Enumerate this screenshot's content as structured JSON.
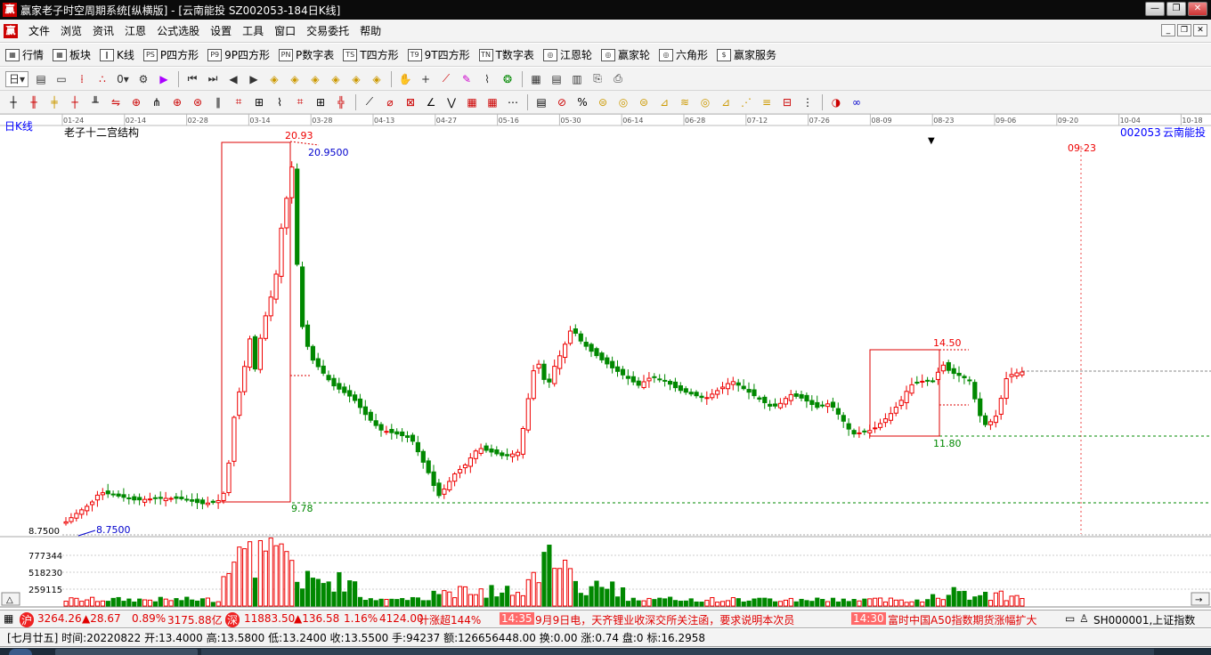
{
  "window": {
    "title": "赢家老子时空周期系统[纵横版] - [云南能投  SZ002053-184日K线]",
    "logo": "赢",
    "buttons": [
      "—",
      "❐",
      "✕"
    ]
  },
  "menu": {
    "logo": "赢",
    "items": [
      "文件",
      "浏览",
      "资讯",
      "江恩",
      "公式选股",
      "设置",
      "工具",
      "窗口",
      "交易委托",
      "帮助"
    ],
    "mdi_buttons": [
      "_",
      "❐",
      "✕"
    ]
  },
  "toolbar": {
    "items": [
      {
        "icon": "grid-icon",
        "glyph": "▦",
        "label": "行情"
      },
      {
        "icon": "blocks-icon",
        "glyph": "▦",
        "label": "板块"
      },
      {
        "icon": "kline-icon",
        "glyph": "‖",
        "label": "K线"
      },
      {
        "icon": "ps-icon",
        "glyph": "PS",
        "label": "P四方形"
      },
      {
        "icon": "p9-icon",
        "glyph": "P9",
        "label": "9P四方形"
      },
      {
        "icon": "pn-icon",
        "glyph": "PN",
        "label": "P数字表"
      },
      {
        "icon": "ts-icon",
        "glyph": "TS",
        "label": "T四方形"
      },
      {
        "icon": "t9-icon",
        "glyph": "T9",
        "label": "9T四方形"
      },
      {
        "icon": "tn-icon",
        "glyph": "TN",
        "label": "T数字表"
      },
      {
        "icon": "gann-wheel-icon",
        "glyph": "◎",
        "label": "江恩轮"
      },
      {
        "icon": "winner-wheel-icon",
        "glyph": "◎",
        "label": "赢家轮"
      },
      {
        "icon": "hexagon-icon",
        "glyph": "◎",
        "label": "六角形"
      },
      {
        "icon": "dollar-icon",
        "glyph": "$",
        "label": "赢家服务"
      }
    ],
    "period_select": "日"
  },
  "chart": {
    "period_label": "日K线",
    "indicator_name": "老子十二宫结构",
    "stock_code": "002053",
    "stock_name": "云南能投",
    "date_ticks": [
      "01-24",
      "02-14",
      "02-28",
      "03-14",
      "03-28",
      "04-13",
      "04-27",
      "05-16",
      "05-30",
      "06-14",
      "06-28",
      "07-12",
      "07-26",
      "08-09",
      "08-23",
      "09-06",
      "09-20",
      "10-04",
      "10-18"
    ],
    "future_date": "09-23",
    "price_labels": {
      "high_box": "20.93",
      "high_price": "20.9500",
      "low_box": "9.78",
      "box2_high": "14.50",
      "box2_low": "11.80",
      "low_price": "8.7500",
      "axis_low": "8.7500"
    },
    "volume_axis": [
      "777344",
      "518230",
      "259115"
    ],
    "marker": "▼"
  },
  "ticker": {
    "sh_index": "3264.26",
    "sh_change": "▲28.67",
    "sh_pct": "0.89%",
    "sh_amount": "3175.88亿",
    "sz_index": "11883.50",
    "sz_change": "▲136.58",
    "sz_pct": "1.16%",
    "sz_amount": "4124.00",
    "news_tail": "计涨超144%",
    "news1_time": "14:35",
    "news1_text": "9月9日电，天齐锂业收深交所关注函，要求说明本次员",
    "news2_time": "14:30",
    "news2_text": "富时中国A50指数期货涨幅扩大",
    "index_code": "SH000001,上证指数"
  },
  "status": {
    "text": "[七月廿五] 时间:20220822 开:13.4000 高:13.5800 低:13.2400 收:13.5500 手:94237 额:126656448.00 换:0.00 涨:0.74 盘:0 标:16.2958"
  }
}
